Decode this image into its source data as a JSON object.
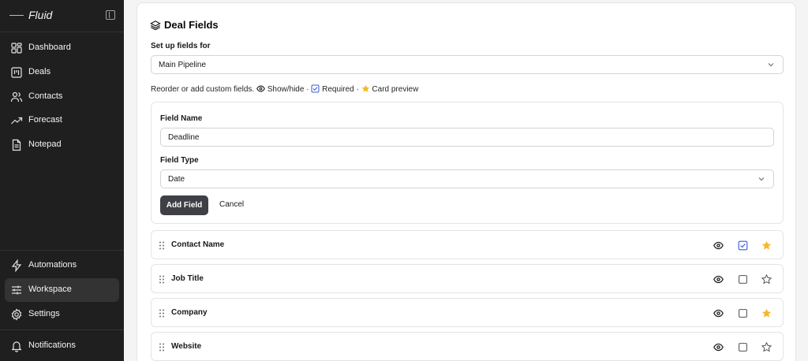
{
  "app": {
    "name": "Fluid"
  },
  "sidebar": {
    "items": [
      {
        "label": "Dashboard",
        "icon": "dashboard-icon"
      },
      {
        "label": "Deals",
        "icon": "kanban-icon"
      },
      {
        "label": "Contacts",
        "icon": "users-icon"
      },
      {
        "label": "Forecast",
        "icon": "trend-icon"
      },
      {
        "label": "Notepad",
        "icon": "document-icon"
      }
    ],
    "bottom_items": [
      {
        "label": "Automations",
        "icon": "bolt-icon"
      },
      {
        "label": "Workspace",
        "icon": "sliders-icon",
        "active": true
      },
      {
        "label": "Settings",
        "icon": "gear-icon"
      },
      {
        "label": "Notifications",
        "icon": "bell-icon"
      }
    ]
  },
  "main": {
    "title": "Deal Fields",
    "setup_label": "Set up fields for",
    "pipeline_select": "Main Pipeline",
    "description": {
      "prefix": "Reorder or add custom fields.",
      "show_hide": "Show/hide",
      "sep1": "·",
      "required": "Required",
      "sep2": "·",
      "card_preview": "Card preview"
    },
    "form": {
      "field_name_label": "Field Name",
      "field_name_value": "Deadline",
      "field_type_label": "Field Type",
      "field_type_value": "Date",
      "add_button": "Add Field",
      "cancel_button": "Cancel"
    },
    "fields": [
      {
        "name": "Contact Name",
        "visible": true,
        "required": true,
        "card_preview": true
      },
      {
        "name": "Job Title",
        "visible": true,
        "required": false,
        "card_preview": false
      },
      {
        "name": "Company",
        "visible": true,
        "required": false,
        "card_preview": true
      },
      {
        "name": "Website",
        "visible": true,
        "required": false,
        "card_preview": false
      }
    ]
  },
  "colors": {
    "sidebar_bg": "#1f1f1f",
    "active_item": "#333333",
    "primary_button": "#3f3f46",
    "star": "#f5b82e",
    "check": "#3b5bdb"
  }
}
